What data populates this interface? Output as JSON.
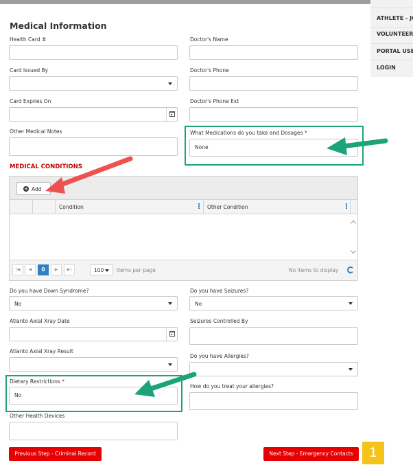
{
  "nav": {
    "items": [
      "ATHLETE - JOI",
      "VOLUNTEER -",
      "PORTAL USER",
      "LOGIN"
    ]
  },
  "section_title": "Medical Information",
  "fields": {
    "health_card_label": "Health Card #",
    "health_card_value": "",
    "doctor_name_label": "Doctor's Name",
    "doctor_name_value": "",
    "card_issued_label": "Card Issued By",
    "card_issued_value": "",
    "doctor_phone_label": "Doctor's Phone",
    "doctor_phone_value": "",
    "card_expires_label": "Card Expires On",
    "card_expires_value": "",
    "doctor_phone_ext_label": "Doctor's Phone Ext",
    "doctor_phone_ext_value": "",
    "other_medical_notes_label": "Other Medical Notes",
    "other_medical_notes_value": "",
    "medications_label": "What Medications do you take and Dosages",
    "medications_required": "*",
    "medications_value": "None"
  },
  "conditions": {
    "title": "MEDICAL CONDITIONS",
    "add_label": "Add",
    "add_icon": "plus-circle-icon",
    "columns": [
      "Condition",
      "Other Condition"
    ],
    "pager": {
      "current_page": "0",
      "page_size": "100",
      "items_per_page": "items per page",
      "empty_text": "No items to display"
    }
  },
  "health": {
    "down_syndrome_label": "Do you have Down Syndrome?",
    "down_syndrome_value": "No",
    "seizures_label": "Do you have Seizures?",
    "seizures_value": "No",
    "atlanto_date_label": "Atlanto Axial Xray Date",
    "atlanto_date_value": "",
    "seizures_controlled_label": "Seizures Controlled By",
    "seizures_controlled_value": "",
    "atlanto_result_label": "Atlanto Axial Xray Result",
    "atlanto_result_value": "",
    "allergies_label": "Do you have Allergies?",
    "allergies_value": "",
    "dietary_label": "Dietary Restrictions",
    "dietary_required": "*",
    "dietary_value": "No",
    "treat_allergies_label": "How do you treat your allergies?",
    "treat_allergies_value": "",
    "other_devices_label": "Other Health Devices",
    "other_devices_value": ""
  },
  "buttons": {
    "previous": "Previous Step - Criminal Record",
    "next": "Next Step - Emergency Contacts"
  },
  "annotation": {
    "badge_number": "1"
  },
  "colors": {
    "accent_red": "#e60000",
    "section_red": "#c00000",
    "highlight_green": "#1ca37a",
    "arrow_red": "#f05050",
    "arrow_green": "#1ca37a",
    "pager_blue": "#2f7fc1",
    "badge_yellow": "#f5c31a"
  }
}
